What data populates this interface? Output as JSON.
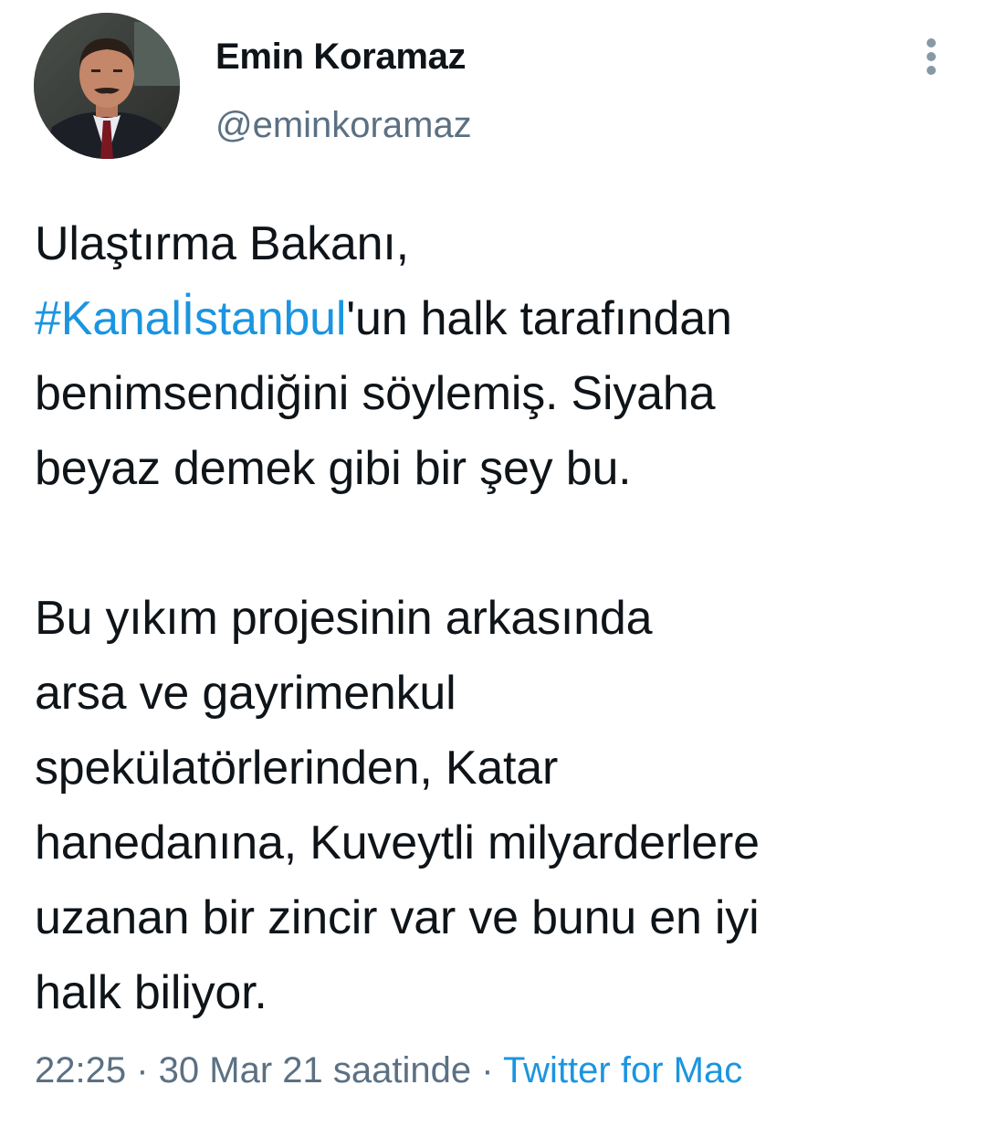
{
  "author": {
    "display_name": "Emin Koramaz",
    "handle": "@eminkoramaz",
    "avatar_icon": "profile-photo"
  },
  "more_icon": "vertical-dots-icon",
  "tweet": {
    "line1": "Ulaştırma Bakanı,",
    "line2_hashtag": "#Kanalİstanbul",
    "line2_rest": "'un halk tarafından",
    "line3": "benimsendiğini söylemiş. Siyaha",
    "line4": "beyaz demek gibi bir şey bu.",
    "line5": "Bu yıkım projesinin arkasında",
    "line6": "arsa ve gayrimenkul",
    "line7": "spekülatörlerinden, Katar",
    "line8": "hanedanına, Kuveytli milyarderlere",
    "line9": "uzanan bir zincir var ve bunu en iyi",
    "line10": "halk biliyor."
  },
  "meta": {
    "time": "22:25",
    "separator1": " · ",
    "date": "30 Mar 21 saatinde",
    "separator2": " · ",
    "source": "Twitter for Mac"
  },
  "colors": {
    "link": "#1b95e0",
    "secondary_text": "#5b7083",
    "primary_text": "#0f1419"
  }
}
